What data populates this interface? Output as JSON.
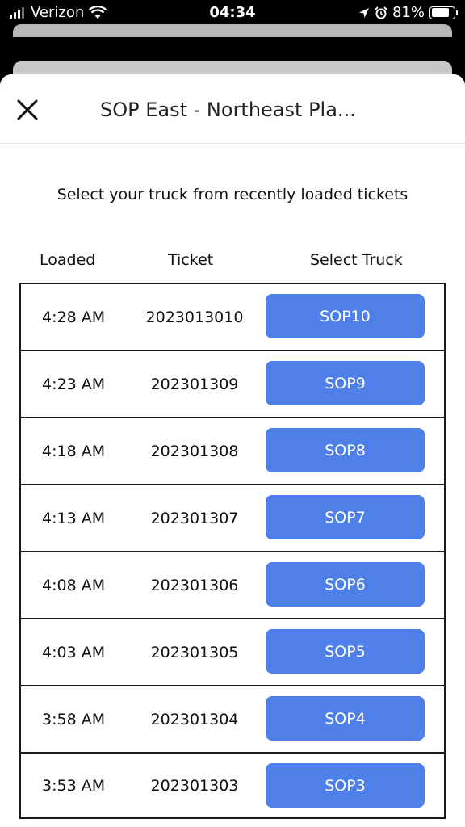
{
  "status_bar": {
    "carrier": "Verizon",
    "time": "04:34",
    "battery": "81%",
    "battery_level": 0.81
  },
  "header": {
    "title": "SOP East - Northeast Pla..."
  },
  "subtitle": "Select your truck from recently loaded tickets",
  "columns": {
    "loaded": "Loaded",
    "ticket": "Ticket",
    "select_truck": "Select Truck"
  },
  "rows": [
    {
      "loaded": "4:28 AM",
      "ticket": "2023013010",
      "truck": "SOP10"
    },
    {
      "loaded": "4:23 AM",
      "ticket": "202301309",
      "truck": "SOP9"
    },
    {
      "loaded": "4:18 AM",
      "ticket": "202301308",
      "truck": "SOP8"
    },
    {
      "loaded": "4:13 AM",
      "ticket": "202301307",
      "truck": "SOP7"
    },
    {
      "loaded": "4:08 AM",
      "ticket": "202301306",
      "truck": "SOP6"
    },
    {
      "loaded": "4:03 AM",
      "ticket": "202301305",
      "truck": "SOP5"
    },
    {
      "loaded": "3:58 AM",
      "ticket": "202301304",
      "truck": "SOP4"
    },
    {
      "loaded": "3:53 AM",
      "ticket": "202301303",
      "truck": "SOP3"
    }
  ],
  "colors": {
    "accent": "#4f7fe8"
  }
}
